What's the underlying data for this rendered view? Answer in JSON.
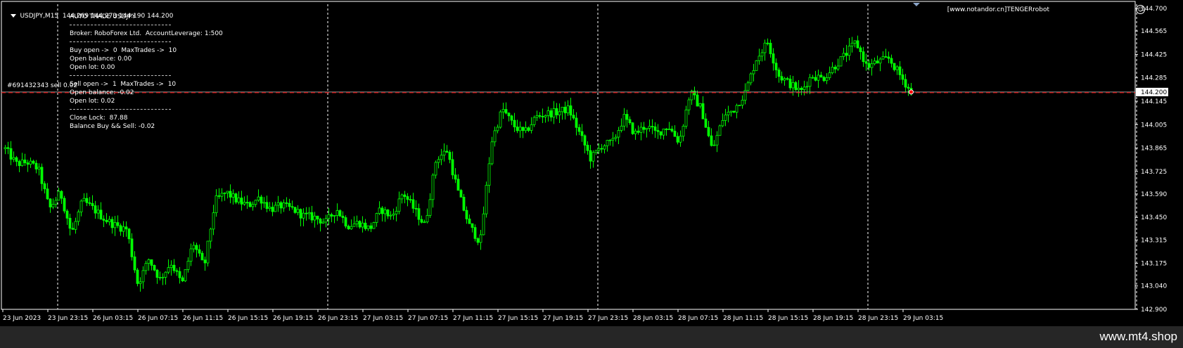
{
  "header": {
    "symbol_line": "USDJPY,M15  144.269 144.273 144.190 144.200"
  },
  "info_panel": {
    "lines": [
      "AUTO TRADE USDJPY",
      "",
      "Broker: RoboForex Ltd.  AccountLeverage: 1:500",
      "",
      "Buy open ->  0  MaxTrades ->  10",
      "Open balance: 0.00",
      "Open lot: 0.00",
      "",
      "Sell open ->  1  MaxTrades ->  10",
      "Open balance: -0.02",
      "Open lot: 0.02",
      "",
      "Close Lock:  87.88",
      "Balance Buy && Sell: -0.02"
    ]
  },
  "order_label": "#691432343 sell 0.02",
  "copyright": "[www.notandor.cn]TENGERrobot",
  "footer": {
    "brand": "www.mt4.shop"
  },
  "colors": {
    "background": "#000000",
    "candles": "#00ff00",
    "grid": "#ffffff",
    "bid_line": "#9a9a9a",
    "order_line": "#ff0000",
    "current_price_box": "#ffffff"
  },
  "icons": [
    "dropdown-triangle-icon",
    "smiley-icon",
    "period-marker-icon"
  ],
  "chart_data": {
    "type": "candlestick",
    "symbol": "USDJPY",
    "timeframe": "M15",
    "current_price": 144.2,
    "ylim": [
      142.9,
      144.7
    ],
    "y_ticks": [
      "144.700",
      "144.565",
      "144.425",
      "144.285",
      "144.145",
      "144.005",
      "143.865",
      "143.725",
      "143.590",
      "143.450",
      "143.315",
      "143.175",
      "143.040",
      "142.900"
    ],
    "x_ticks": [
      "23 Jun 2023",
      "23 Jun 23:15",
      "26 Jun 03:15",
      "26 Jun 07:15",
      "26 Jun 11:15",
      "26 Jun 15:15",
      "26 Jun 19:15",
      "26 Jun 23:15",
      "27 Jun 03:15",
      "27 Jun 07:15",
      "27 Jun 11:15",
      "27 Jun 15:15",
      "27 Jun 19:15",
      "27 Jun 23:15",
      "28 Jun 03:15",
      "28 Jun 07:15",
      "28 Jun 11:15",
      "28 Jun 15:15",
      "28 Jun 19:15",
      "28 Jun 23:15",
      "29 Jun 03:15"
    ],
    "price_path": [
      143.86,
      143.77,
      143.78,
      143.74,
      143.5,
      143.6,
      143.35,
      143.55,
      143.5,
      143.44,
      143.4,
      143.38,
      143.05,
      143.2,
      143.08,
      143.18,
      143.05,
      143.3,
      143.15,
      143.55,
      143.6,
      143.55,
      143.52,
      143.57,
      143.5,
      143.52,
      143.5,
      143.46,
      143.45,
      143.42,
      143.5,
      143.4,
      143.42,
      143.38,
      143.5,
      143.45,
      143.6,
      143.5,
      143.4,
      143.8,
      143.85,
      143.6,
      143.4,
      143.3,
      143.9,
      144.1,
      144.0,
      143.95,
      144.05,
      144.07,
      144.08,
      144.1,
      143.95,
      143.8,
      143.88,
      143.9,
      144.05,
      143.95,
      144.0,
      143.95,
      144.0,
      143.9,
      144.2,
      144.1,
      143.85,
      144.05,
      144.1,
      144.2,
      144.4,
      144.5,
      144.3,
      144.25,
      144.2,
      144.3,
      144.28,
      144.35,
      144.42,
      144.5,
      144.35,
      144.38,
      144.4,
      144.3,
      144.2
    ]
  }
}
